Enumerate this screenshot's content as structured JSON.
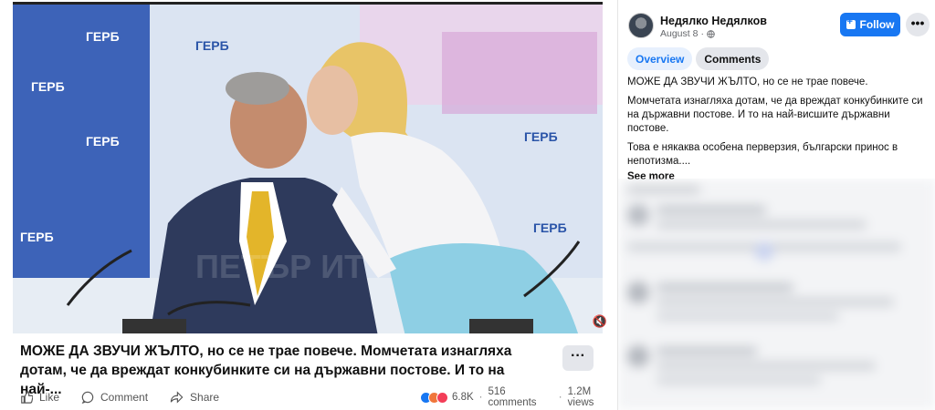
{
  "post": {
    "caption": "МОЖЕ ДА ЗВУЧИ ЖЪЛТО, но се не трае повече. Момчетата изнагляха дотам, че да вреждат конкубинките си на държавни постове. И то на най-...",
    "video_watermark": "ГЕРБ"
  },
  "actions": {
    "like": "Like",
    "comment": "Comment",
    "share": "Share"
  },
  "stats": {
    "reactions": "6.8K",
    "comments": "516 comments",
    "views": "1.2M views",
    "separator": "·"
  },
  "author": {
    "name": "Недялко Недялков",
    "date": "August 8",
    "separator": "·"
  },
  "header": {
    "follow_label": "Follow",
    "more_label": "•••"
  },
  "tabs": [
    {
      "label": "Overview",
      "active": true
    },
    {
      "label": "Comments",
      "active": false
    }
  ],
  "description": {
    "p1": "МОЖЕ ДА ЗВУЧИ ЖЪЛТО, но се не трае повече.",
    "p2": "Момчетата изнагляха дотам, че да вреждат конкубинките си на държавни постове. И то на най-висшите държавни постове.",
    "p3": "Това е някаква особена перверзия, български принос в непотизма....",
    "see_more": "See more"
  },
  "colors": {
    "brand_blue": "#1877f2",
    "button_gray": "#e4e6eb",
    "like_blue": "#1877f2",
    "angry_orange": "#f0763b",
    "love_red": "#f33e58"
  }
}
